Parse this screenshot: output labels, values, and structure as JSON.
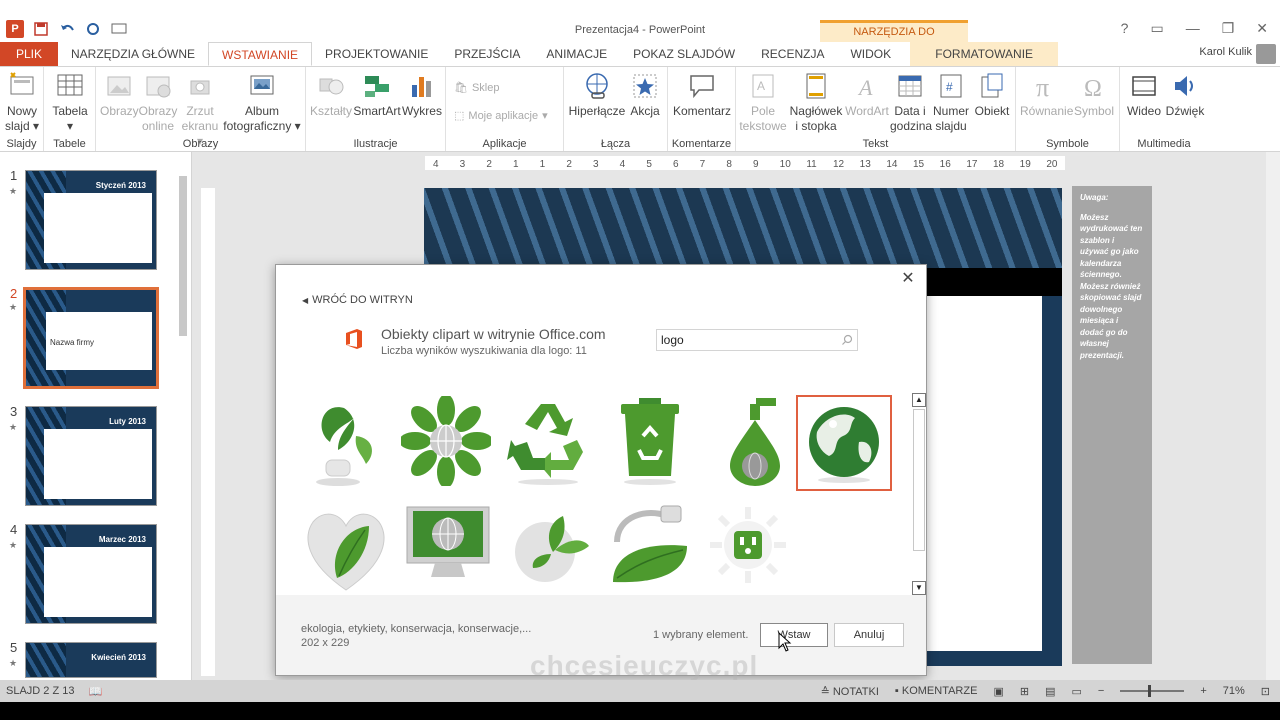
{
  "window": {
    "title": "Prezentacja4 - PowerPoint",
    "context_tools": "NARZĘDZIA DO RYSOWANIA",
    "user": "Karol Kulik",
    "accent": "#d24726"
  },
  "tabs": [
    {
      "label": "PLIK"
    },
    {
      "label": "NARZĘDZIA GŁÓWNE"
    },
    {
      "label": "WSTAWIANIE"
    },
    {
      "label": "PROJEKTOWANIE"
    },
    {
      "label": "PRZEJŚCIA"
    },
    {
      "label": "ANIMACJE"
    },
    {
      "label": "POKAZ SLAJDÓW"
    },
    {
      "label": "RECENZJA"
    },
    {
      "label": "WIDOK"
    },
    {
      "label": "FORMATOWANIE"
    }
  ],
  "ribbon": {
    "slajdy": {
      "group": "Slajdy",
      "new_slide_1": "Nowy",
      "new_slide_2": "slajd ▾"
    },
    "tabele": {
      "group": "Tabele",
      "table_1": "Tabela",
      "table_2": "▾"
    },
    "obrazy": {
      "group": "Obrazy",
      "pictures": "Obrazy",
      "online_1": "Obrazy",
      "online_2": "online",
      "screenshot_1": "Zrzut",
      "screenshot_2": "ekranu ▾",
      "album_1": "Album",
      "album_2": "fotograficzny ▾"
    },
    "ilustracje": {
      "group": "Ilustracje",
      "shapes": "Kształty",
      "smartart": "SmartArt",
      "chart": "Wykres"
    },
    "aplikacje": {
      "group": "Aplikacje",
      "store": "Sklep",
      "my_apps": "Moje aplikacje"
    },
    "lacza": {
      "group": "Łącza",
      "hyperlink": "Hiperłącze",
      "action": "Akcja"
    },
    "komentarze": {
      "group": "Komentarze",
      "comment": "Komentarz"
    },
    "tekst": {
      "group": "Tekst",
      "textbox_1": "Pole",
      "textbox_2": "tekstowe",
      "header_1": "Nagłówek",
      "header_2": "i stopka",
      "wordart": "WordArt",
      "datetime_1": "Data i",
      "datetime_2": "godzina",
      "slidenum_1": "Numer",
      "slidenum_2": "slajdu",
      "object": "Obiekt"
    },
    "symbole": {
      "group": "Symbole",
      "equation": "Równanie",
      "symbol": "Symbol"
    },
    "multimedia": {
      "group": "Multimedia",
      "video": "Wideo",
      "audio": "Dźwięk"
    }
  },
  "ruler": [
    "4",
    "3",
    "2",
    "1",
    "1",
    "2",
    "3",
    "4",
    "5",
    "6",
    "7",
    "8",
    "9",
    "10",
    "11",
    "12",
    "13",
    "14",
    "15",
    "16",
    "17",
    "18",
    "19",
    "20"
  ],
  "slides": [
    {
      "num": "1",
      "title": "Styczeń 2013"
    },
    {
      "num": "2",
      "title": "Nazwa firmy"
    },
    {
      "num": "3",
      "title": "Luty 2013"
    },
    {
      "num": "4",
      "title": "Marzec 2013"
    },
    {
      "num": "5",
      "title": "Kwiecień 2013"
    }
  ],
  "note": {
    "heading": "Uwaga:",
    "body": "Możesz wydrukować ten szablon i używać go jako kalendarza ściennego. Możesz również skopiować slajd dowolnego miesiąca i dodać go do własnej prezentacji."
  },
  "dialog": {
    "back": "WRÓĆ DO WITRYN",
    "provider_title": "Obiekty clipart w witrynie Office.com",
    "results_count": "Liczba wyników wyszukiwania dla logo: 11",
    "search_value": "logo",
    "keywords": "ekologia, etykiety, konserwacja, konserwacje,...",
    "dimensions": "202 x 229",
    "selected_count": "1 wybrany element.",
    "insert": "Wstaw",
    "cancel": "Anuluj",
    "clips": [
      {
        "name": "leaf-car-clip"
      },
      {
        "name": "flower-globe-clip"
      },
      {
        "name": "recycle-symbol-clip"
      },
      {
        "name": "recycle-bin-clip"
      },
      {
        "name": "globe-drop-clip"
      },
      {
        "name": "green-globe-clip",
        "selected": true
      },
      {
        "name": "heart-leaf-clip"
      },
      {
        "name": "monitor-globe-clip"
      },
      {
        "name": "butterfly-globe-clip"
      },
      {
        "name": "fuel-leaf-clip"
      },
      {
        "name": "sun-outlet-clip"
      }
    ]
  },
  "status": {
    "slide": "SLAJD 2 Z 13",
    "notes": "NOTATKI",
    "comments": "KOMENTARZE",
    "zoom": "71%"
  },
  "watermark": "chcesieuczyc.pl"
}
